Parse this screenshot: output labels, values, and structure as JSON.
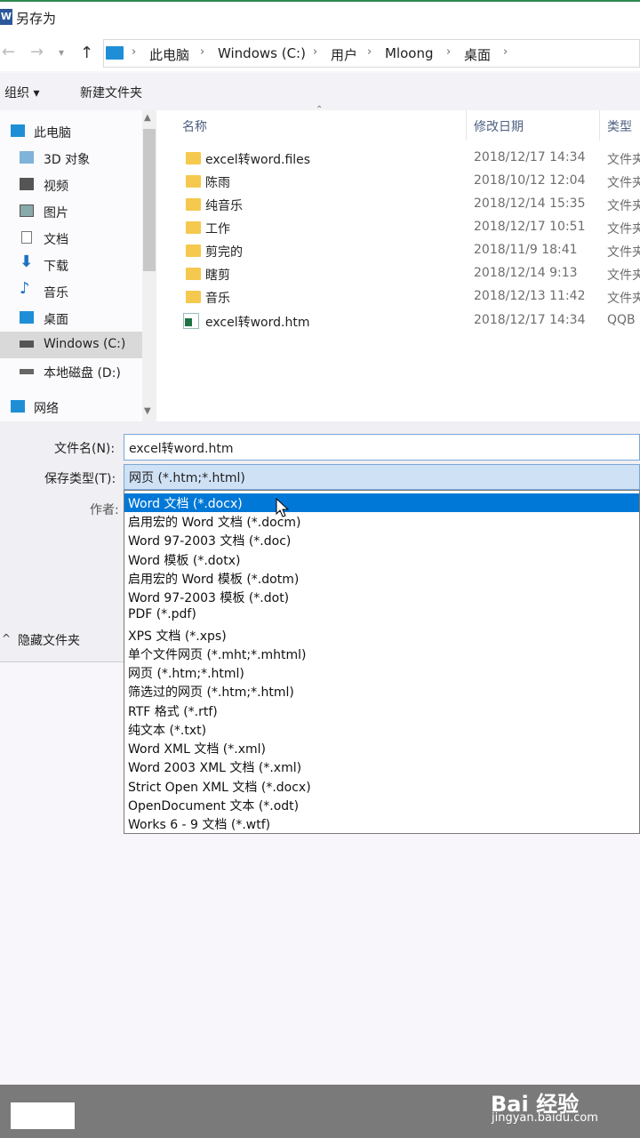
{
  "window": {
    "title": "另存为",
    "app_icon": "W"
  },
  "address": {
    "crumbs": [
      "此电脑",
      "Windows (C:)",
      "用户",
      "Mloong",
      "桌面"
    ]
  },
  "toolbar": {
    "organize": "组织 ▾",
    "new_folder": "新建文件夹"
  },
  "sidebar": {
    "items": [
      {
        "label": "此电脑",
        "icon": "computer-icon"
      },
      {
        "label": "3D 对象",
        "icon": "cube-icon"
      },
      {
        "label": "视频",
        "icon": "video-icon"
      },
      {
        "label": "图片",
        "icon": "picture-icon"
      },
      {
        "label": "文档",
        "icon": "document-icon"
      },
      {
        "label": "下载",
        "icon": "download-icon"
      },
      {
        "label": "音乐",
        "icon": "music-icon"
      },
      {
        "label": "桌面",
        "icon": "desktop-icon"
      },
      {
        "label": "Windows (C:)",
        "icon": "drive-icon"
      },
      {
        "label": "本地磁盘 (D:)",
        "icon": "drive-icon"
      },
      {
        "label": "网络",
        "icon": "network-icon"
      }
    ]
  },
  "columns": {
    "name": "名称",
    "date": "修改日期",
    "type": "类型"
  },
  "files": [
    {
      "name": "excel转word.files",
      "date": "2018/12/17 14:34",
      "type": "文件夹",
      "kind": "folder"
    },
    {
      "name": "陈雨",
      "date": "2018/10/12 12:04",
      "type": "文件夹",
      "kind": "folder"
    },
    {
      "name": "纯音乐",
      "date": "2018/12/14 15:35",
      "type": "文件夹",
      "kind": "folder"
    },
    {
      "name": "工作",
      "date": "2018/12/17 10:51",
      "type": "文件夹",
      "kind": "folder"
    },
    {
      "name": "剪完的",
      "date": "2018/11/9 18:41",
      "type": "文件夹",
      "kind": "folder"
    },
    {
      "name": "瞎剪",
      "date": "2018/12/14 9:13",
      "type": "文件夹",
      "kind": "folder"
    },
    {
      "name": "音乐",
      "date": "2018/12/13 11:42",
      "type": "文件夹",
      "kind": "folder"
    },
    {
      "name": "excel转word.htm",
      "date": "2018/12/17 14:34",
      "type": "QQB",
      "kind": "htm"
    }
  ],
  "form": {
    "filename_label": "文件名(N):",
    "filename_value": "excel转word.htm",
    "filetype_label": "保存类型(T):",
    "filetype_value": "网页 (*.htm;*.html)",
    "author_label": "作者:",
    "hide_folders": "隐藏文件夹"
  },
  "dropdown_options": [
    "Word 文档 (*.docx)",
    "启用宏的 Word 文档 (*.docm)",
    "Word 97-2003 文档 (*.doc)",
    "Word 模板 (*.dotx)",
    "启用宏的 Word 模板 (*.dotm)",
    "Word 97-2003 模板 (*.dot)",
    "PDF (*.pdf)",
    "XPS 文档 (*.xps)",
    "单个文件网页 (*.mht;*.mhtml)",
    "网页 (*.htm;*.html)",
    "筛选过的网页 (*.htm;*.html)",
    "RTF 格式 (*.rtf)",
    "纯文本 (*.txt)",
    "Word XML 文档 (*.xml)",
    "Word 2003 XML 文档 (*.xml)",
    "Strict Open XML 文档 (*.docx)",
    "OpenDocument 文本 (*.odt)",
    "Works 6 - 9 文档 (*.wtf)"
  ],
  "selected_option": 0,
  "watermark": {
    "brand": "Bai 经验",
    "url": "jingyan.baidu.com"
  },
  "colors": {
    "selection": "#0078d7",
    "folder": "#f5c94e",
    "word_blue": "#2b579a"
  }
}
